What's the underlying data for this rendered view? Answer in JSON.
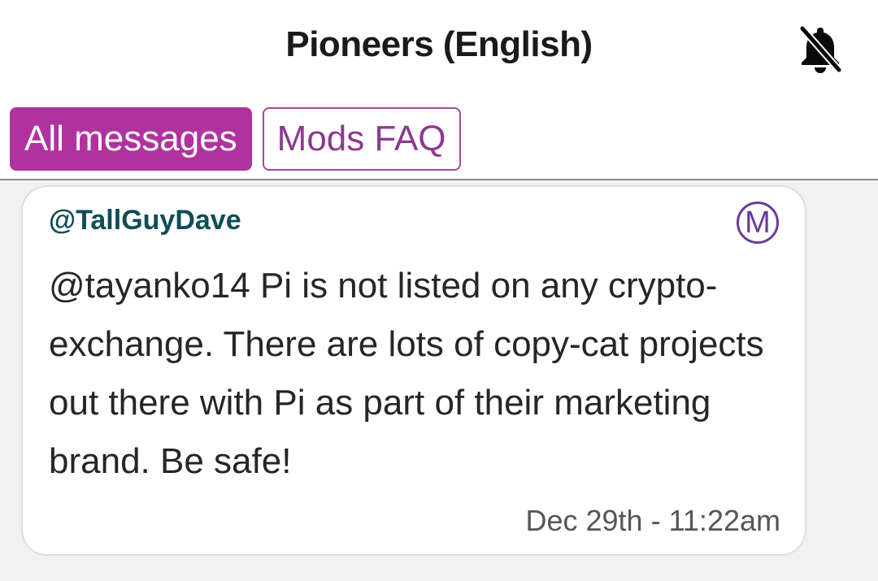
{
  "header": {
    "title": "Pioneers (English)",
    "notification_icon": "bell-off-icon"
  },
  "tabs": [
    {
      "label": "All messages",
      "active": true
    },
    {
      "label": "Mods FAQ",
      "active": false
    }
  ],
  "message": {
    "author": "@TallGuyDave",
    "badge": "M",
    "text": "@tayanko14 Pi is not listed on any crypto-exchange. There are lots of copy-cat projects out there with Pi as part of their marketing brand. Be safe!",
    "timestamp": "Dec 29th - 11:22am"
  },
  "colors": {
    "accent": "#b1329f",
    "author": "#0f4d55",
    "badge": "#6b3a9c",
    "background": "#f1f1f1"
  }
}
